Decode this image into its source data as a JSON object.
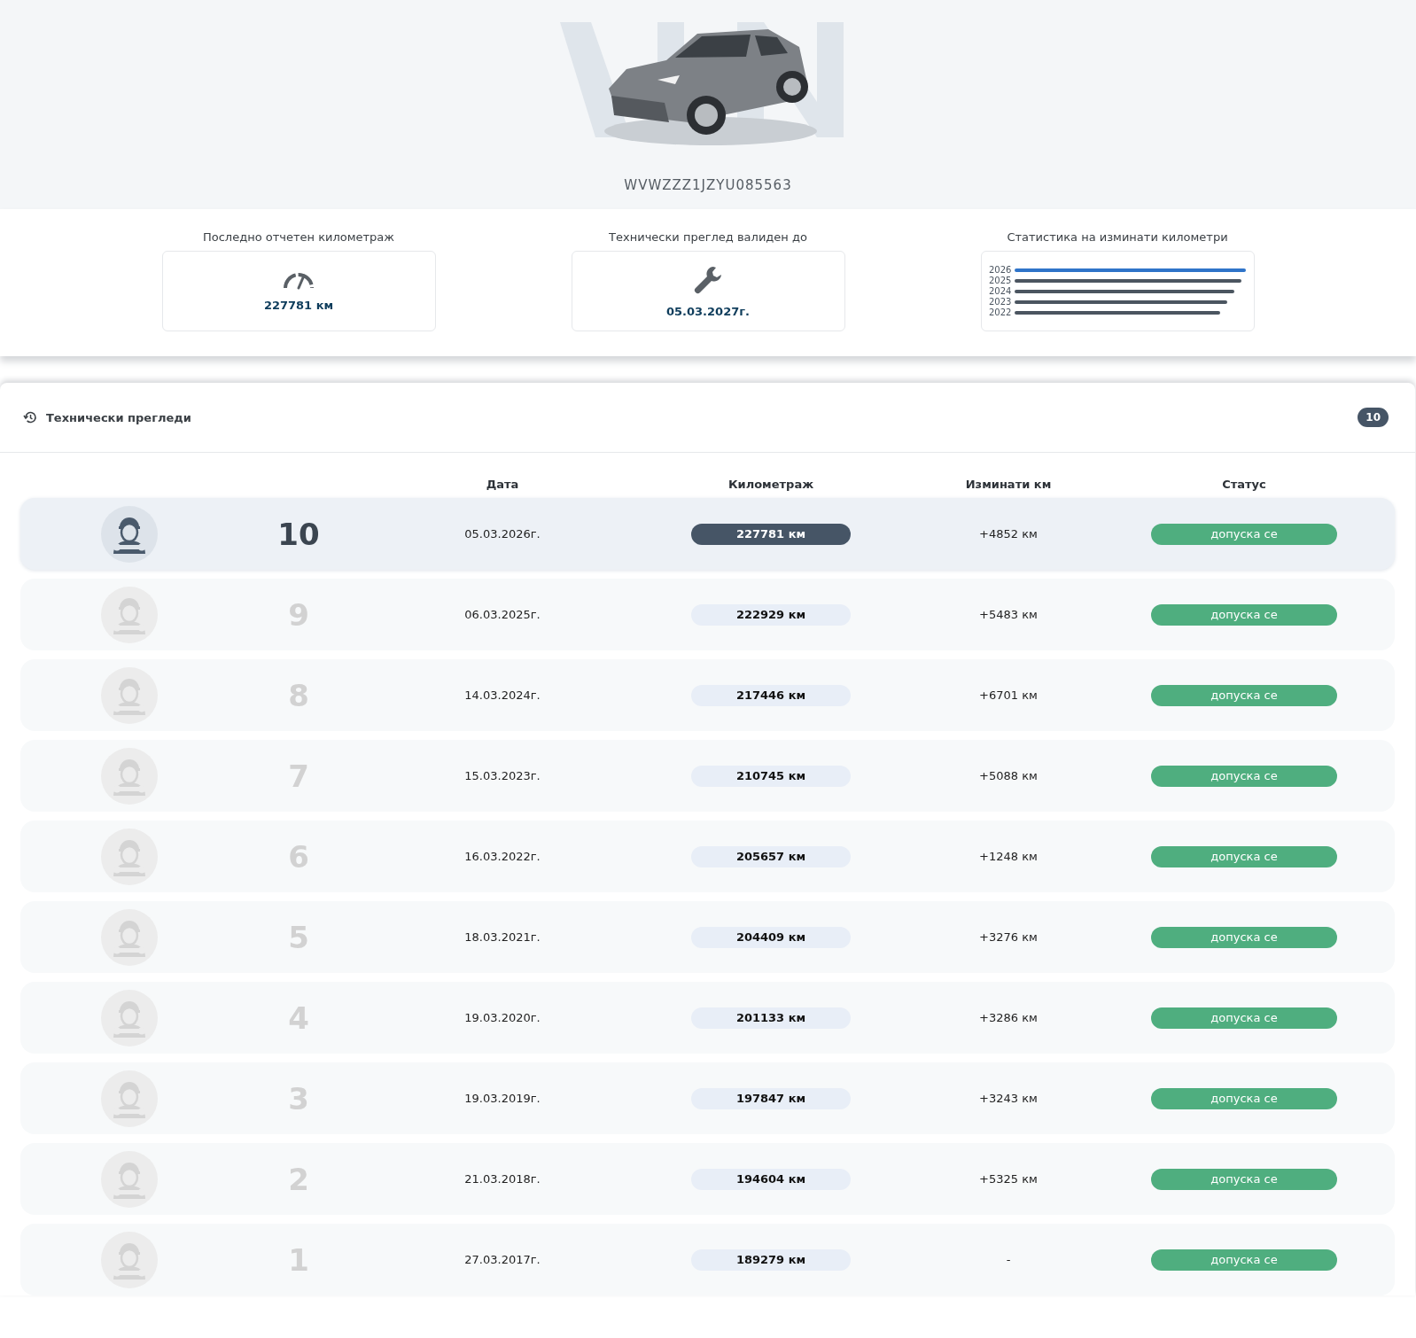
{
  "vehicle": {
    "vin": "WVWZZZ1JZYU085563"
  },
  "summary": [
    {
      "kind": "mileage",
      "label": "Последно отчетен километраж",
      "value": "227781 км"
    },
    {
      "kind": "inspection",
      "label": "Технически преглед валиден до",
      "value": "05.03.2027г."
    },
    {
      "kind": "stats",
      "label": "Статистика на изминати километри",
      "years": [
        {
          "year": "2026",
          "level": 1.0,
          "selected": true
        },
        {
          "year": "2025",
          "level": 0.98,
          "selected": false
        },
        {
          "year": "2024",
          "level": 0.95,
          "selected": false
        },
        {
          "year": "2023",
          "level": 0.92,
          "selected": false
        },
        {
          "year": "2022",
          "level": 0.89,
          "selected": false
        }
      ]
    }
  ],
  "inspections": {
    "title": "Технически прегледи",
    "count": "10",
    "columns": [
      "Дата",
      "Километраж",
      "Изминати км",
      "Статус"
    ],
    "rows": [
      {
        "number": "10",
        "date": "05.03.2026г.",
        "mileage": "227781 км",
        "delta": "+4852 км",
        "status": "допуска се",
        "selected": true
      },
      {
        "number": "9",
        "date": "06.03.2025г.",
        "mileage": "222929 км",
        "delta": "+5483 км",
        "status": "допуска се",
        "selected": false
      },
      {
        "number": "8",
        "date": "14.03.2024г.",
        "mileage": "217446 км",
        "delta": "+6701 км",
        "status": "допуска се",
        "selected": false
      },
      {
        "number": "7",
        "date": "15.03.2023г.",
        "mileage": "210745 км",
        "delta": "+5088 км",
        "status": "допуска се",
        "selected": false
      },
      {
        "number": "6",
        "date": "16.03.2022г.",
        "mileage": "205657 км",
        "delta": "+1248 км",
        "status": "допуска се",
        "selected": false
      },
      {
        "number": "5",
        "date": "18.03.2021г.",
        "mileage": "204409 км",
        "delta": "+3276 км",
        "status": "допуска се",
        "selected": false
      },
      {
        "number": "4",
        "date": "19.03.2020г.",
        "mileage": "201133 км",
        "delta": "+3286 км",
        "status": "допуска се",
        "selected": false
      },
      {
        "number": "3",
        "date": "19.03.2019г.",
        "mileage": "197847 км",
        "delta": "+3243 км",
        "status": "допуска се",
        "selected": false
      },
      {
        "number": "2",
        "date": "21.03.2018г.",
        "mileage": "194604 км",
        "delta": "+5325 км",
        "status": "допуска се",
        "selected": false
      },
      {
        "number": "1",
        "date": "27.03.2017г.",
        "mileage": "189279 км",
        "delta": "-",
        "status": "допуска се",
        "selected": false
      }
    ]
  }
}
